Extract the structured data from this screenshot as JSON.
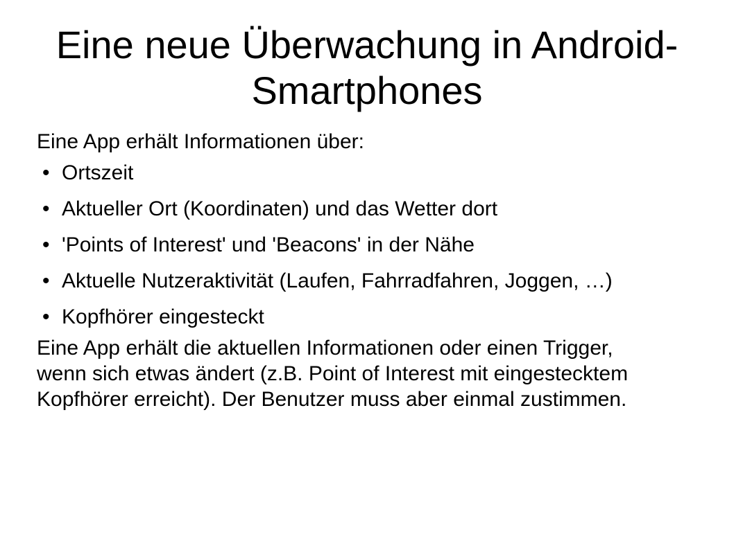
{
  "slide": {
    "title_line1": "Eine neue Überwachung in Android-",
    "title_line2": "Smartphones",
    "intro": "Eine App erhält Informationen über:",
    "bullet_symbol": "•",
    "bullets": [
      "Ortszeit",
      "Aktueller Ort (Koordinaten) und das Wetter dort",
      "'Points of Interest' und 'Beacons' in der Nähe",
      "Aktuelle Nutzeraktivität (Laufen, Fahrradfahren, Joggen, …)",
      "Kopfhörer eingesteckt"
    ],
    "outro_line1": "Eine App erhält die aktuellen Informationen oder einen Trigger,",
    "outro_line2": "wenn sich etwas ändert (z.B. Point of Interest mit eingestecktem",
    "outro_line3": "Kopfhörer erreicht). Der Benutzer muss aber einmal zustimmen."
  }
}
